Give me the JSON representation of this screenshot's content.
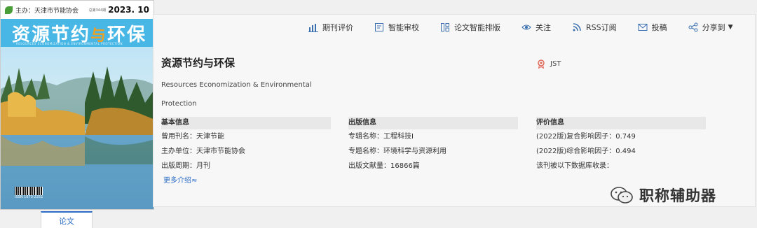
{
  "toolbar": {
    "items": [
      {
        "label": "期刊评价",
        "icon": "bar-chart-icon"
      },
      {
        "label": "智能审校",
        "icon": "document-check-icon"
      },
      {
        "label": "论文智能排版",
        "icon": "layout-icon"
      },
      {
        "label": "关注",
        "icon": "eye-icon"
      },
      {
        "label": "RSS订阅",
        "icon": "rss-icon"
      },
      {
        "label": "投稿",
        "icon": "envelope-icon"
      },
      {
        "label": "分享到",
        "icon": "share-icon"
      }
    ]
  },
  "cover": {
    "sponsor": "主办：天津市节能协会",
    "small": "总第344期",
    "issue": "2023. 10",
    "title_a": "资源节约",
    "title_b": "与",
    "title_c": "环保",
    "subtitle": "RESOURCES ECONOMIZATION & ENVIRONMENTAL PROTECTION",
    "issn": "ISSN 1673-2251"
  },
  "journal": {
    "title": "资源节约与环保",
    "en_title": "Resources Economization & Environmental Protection",
    "badge": "JST"
  },
  "basic": {
    "header": "基本信息",
    "rows": [
      {
        "k": "曾用刊名：",
        "v": "天津节能"
      },
      {
        "k": "主办单位：",
        "v": "天津市节能协会"
      },
      {
        "k": "出版周期：",
        "v": "月刊"
      }
    ],
    "more": "更多介绍≈"
  },
  "publish": {
    "header": "出版信息",
    "rows": [
      {
        "k": "专辑名称：",
        "v": "工程科技I"
      },
      {
        "k": "专题名称：",
        "v": "环境科学与资源利用"
      },
      {
        "k": "出版文献量：",
        "v": "16866篇"
      }
    ]
  },
  "eval": {
    "header": "评价信息",
    "rows": [
      {
        "k": "(2022版)复合影响因子：",
        "v": "0.749"
      },
      {
        "k": "(2022版)综合影响因子：",
        "v": "0.494"
      },
      {
        "k": "该刊被以下数据库收录：",
        "v": ""
      }
    ]
  },
  "tab": {
    "label": "论文"
  },
  "watermark": {
    "text": "职称辅助器"
  },
  "colors": {
    "accent": "#2b6cc4",
    "cover_band": "#48b7e6"
  }
}
